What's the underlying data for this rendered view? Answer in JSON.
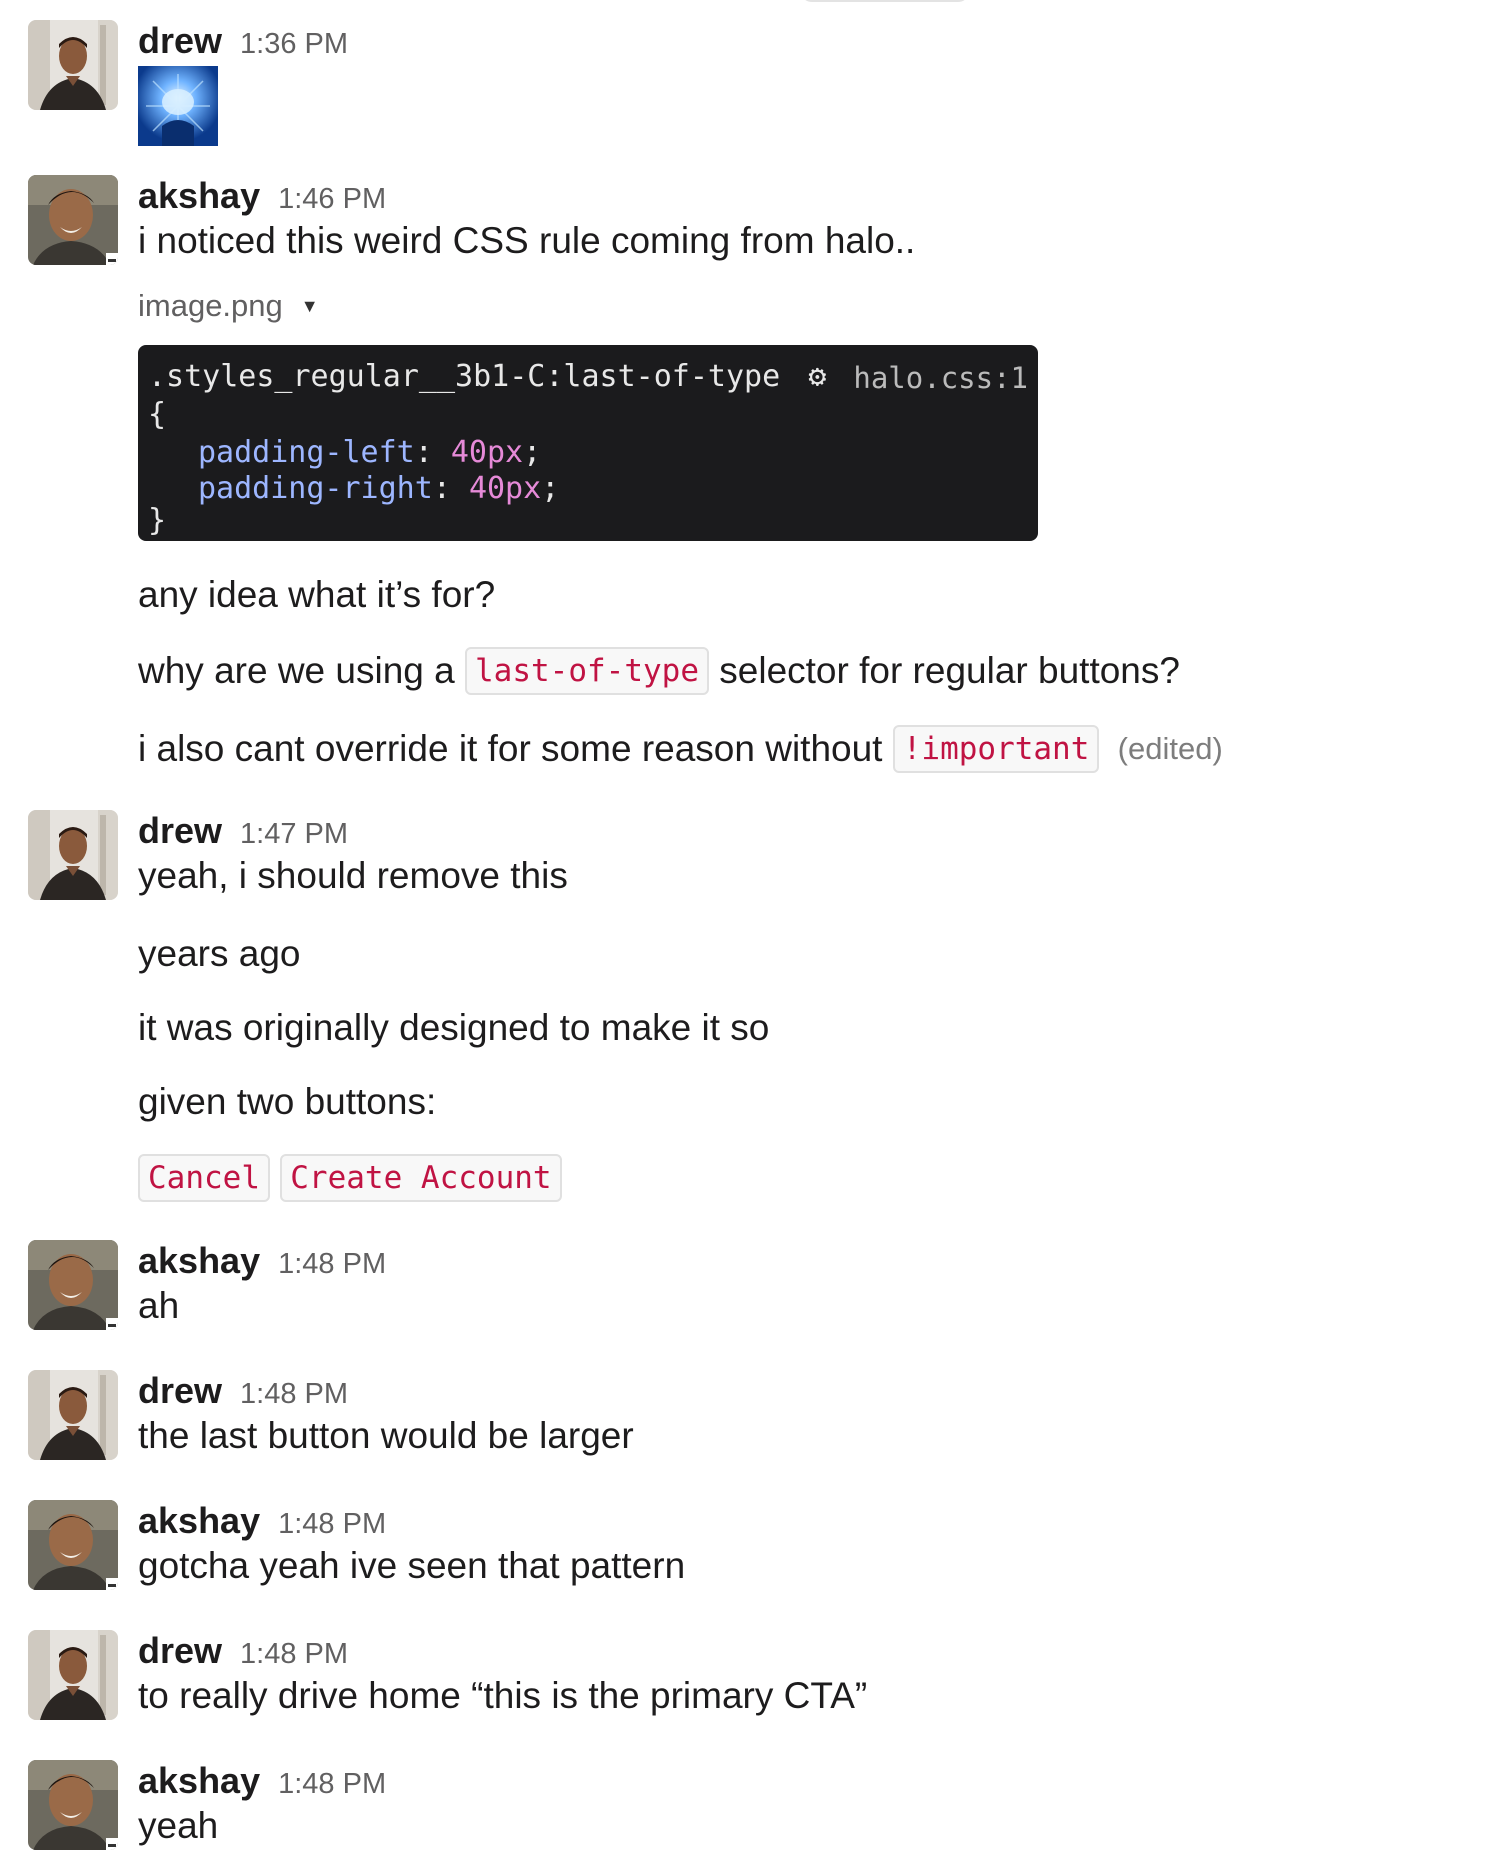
{
  "messages": [
    {
      "user": "drew",
      "time": "1:36 PM",
      "avatar": "drew-avatar",
      "attachment": "brain-gif"
    },
    {
      "user": "akshay",
      "time": "1:46 PM",
      "avatar": "akshay-avatar",
      "lines": {
        "l1": "i noticed this weird CSS rule coming from halo..",
        "file_name": "image.png",
        "code_image": {
          "selector": ".styles_regular__3b1-C:last-of-type",
          "source": "halo.css:1",
          "open_brace": "{",
          "prop1": "padding-left",
          "val1": "40px",
          "prop2": "padding-right",
          "val2": "40px",
          "close_brace": "}",
          "colon": ":",
          "semicolon": ";"
        },
        "l2": "any idea what it’s for?",
        "l3_before": "why are we using a",
        "l3_code": "last-of-type",
        "l3_after": "selector for regular buttons?",
        "l4_before": "i also cant override it for some reason without",
        "l4_code": "!important",
        "l4_edited": "(edited)"
      }
    },
    {
      "user": "drew",
      "time": "1:47 PM",
      "avatar": "drew-avatar",
      "lines": {
        "l1": "yeah, i should remove this",
        "l2": "years ago",
        "l3": "it was originally designed to make it so",
        "l4": "given two buttons:",
        "code1": "Cancel",
        "code2": "Create Account"
      }
    },
    {
      "user": "akshay",
      "time": "1:48 PM",
      "avatar": "akshay-avatar",
      "text": "ah"
    },
    {
      "user": "drew",
      "time": "1:48 PM",
      "avatar": "drew-avatar",
      "text": "the last button would be larger"
    },
    {
      "user": "akshay",
      "time": "1:48 PM",
      "avatar": "akshay-avatar",
      "text": "gotcha yeah ive seen that pattern"
    },
    {
      "user": "drew",
      "time": "1:48 PM",
      "avatar": "drew-avatar",
      "text": "to really drive home “this is the primary CTA”"
    },
    {
      "user": "akshay",
      "time": "1:48 PM",
      "avatar": "akshay-avatar",
      "text": "yeah"
    }
  ],
  "colors": {
    "code_text": "#c01343",
    "timestamp": "#616061",
    "code_image_bg": "#1b1b1d"
  }
}
